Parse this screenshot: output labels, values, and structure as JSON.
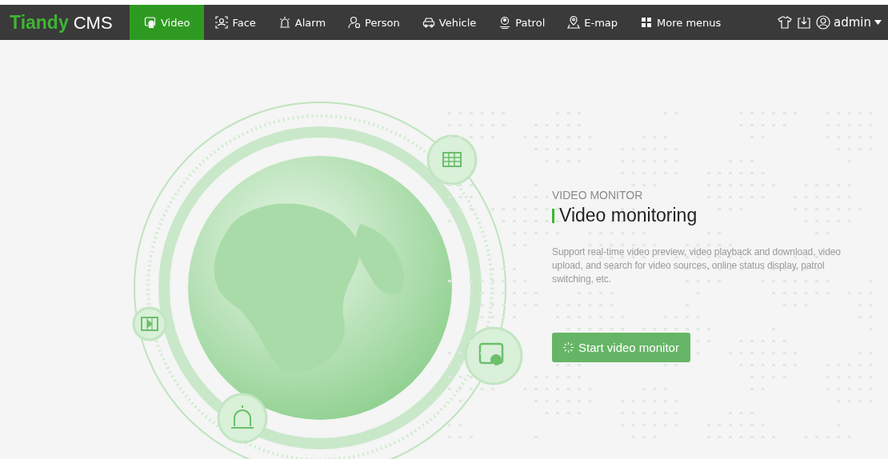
{
  "navbar": {
    "logo_brand": "Tiandy",
    "logo_product": "CMS",
    "tabs": [
      {
        "label": "Video",
        "kind": "camera",
        "selected": true
      },
      {
        "label": "Face",
        "kind": "face",
        "selected": false
      },
      {
        "label": "Alarm",
        "kind": "alarm",
        "selected": false
      },
      {
        "label": "Person",
        "kind": "person",
        "selected": false
      },
      {
        "label": "Vehicle",
        "kind": "car",
        "selected": false
      },
      {
        "label": "Patrol",
        "kind": "patrol",
        "selected": false
      },
      {
        "label": "E-map",
        "kind": "pin",
        "selected": false
      },
      {
        "label": "More menus",
        "kind": "grid",
        "selected": false
      }
    ],
    "user": "admin"
  },
  "hero": {
    "eyebrow": "VIDEO MONITOR",
    "title": "Video monitoring",
    "description": "Support real-time video preview, video playback and download, video upload, and search for video sources, online status display, patrol switching, etc.",
    "button": "Start video monitor"
  }
}
